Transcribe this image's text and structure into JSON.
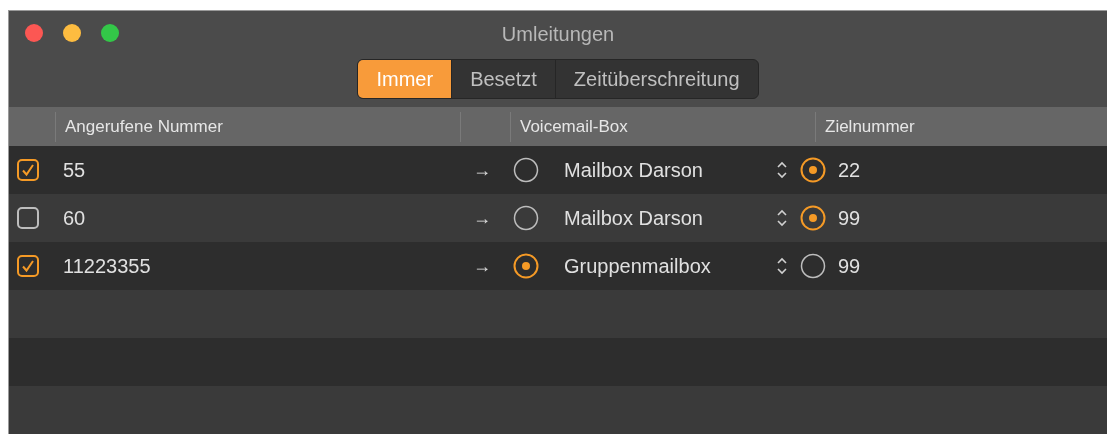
{
  "window": {
    "title": "Umleitungen"
  },
  "tabs": [
    {
      "label": "Immer",
      "selected": true
    },
    {
      "label": "Besetzt",
      "selected": false
    },
    {
      "label": "Zeitüberschreitung",
      "selected": false
    }
  ],
  "table": {
    "columns": [
      "Angerufene Nummer",
      "Voicemail-Box",
      "Zielnummer"
    ],
    "rows": [
      {
        "checked": true,
        "number": "55",
        "arrow": "→",
        "voicemail_selected": false,
        "mailbox": "Mailbox Darson",
        "target_selected": true,
        "target": "22"
      },
      {
        "checked": false,
        "number": "60",
        "arrow": "→",
        "voicemail_selected": false,
        "mailbox": "Mailbox Darson",
        "target_selected": true,
        "target": "99"
      },
      {
        "checked": true,
        "number": "11223355",
        "arrow": "→",
        "voicemail_selected": true,
        "mailbox": "Gruppenmailbox",
        "target_selected": false,
        "target": "99"
      }
    ]
  }
}
